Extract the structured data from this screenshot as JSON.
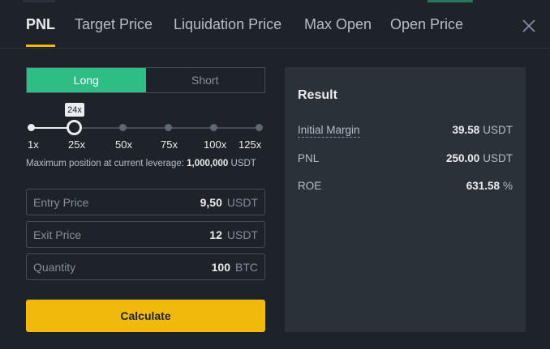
{
  "tabs": [
    {
      "label": "PNL",
      "active": true
    },
    {
      "label": "Target Price",
      "active": false
    },
    {
      "label": "Liquidation Price",
      "active": false
    },
    {
      "label": "Max Open",
      "active": false
    },
    {
      "label": "Open Price",
      "active": false
    }
  ],
  "side": {
    "long": "Long",
    "short": "Short",
    "selected": "Long"
  },
  "leverage": {
    "current": "24x",
    "marks": [
      "1x",
      "25x",
      "50x",
      "75x",
      "100x",
      "125x"
    ],
    "max_position_label": "Maximum position at current leverage:",
    "max_position_value": "1,000,000",
    "max_position_unit": "USDT"
  },
  "fields": [
    {
      "label": "Entry Price",
      "value": "9,50",
      "unit": "USDT"
    },
    {
      "label": "Exit Price",
      "value": "12",
      "unit": "USDT"
    },
    {
      "label": "Quantity",
      "value": "100",
      "unit": "BTC"
    }
  ],
  "calculate_label": "Calculate",
  "result": {
    "title": "Result",
    "rows": [
      {
        "label": "Initial Margin",
        "value": "39.58",
        "unit": "USDT"
      },
      {
        "label": "PNL",
        "value": "250.00",
        "unit": "USDT"
      },
      {
        "label": "ROE",
        "value": "631.58",
        "unit": "%"
      }
    ]
  },
  "colors": {
    "accent": "#f0b90b",
    "long": "#2ebd85",
    "panel": "#2b3139",
    "background": "#1e2329"
  },
  "icons": {
    "close": "close-icon"
  }
}
